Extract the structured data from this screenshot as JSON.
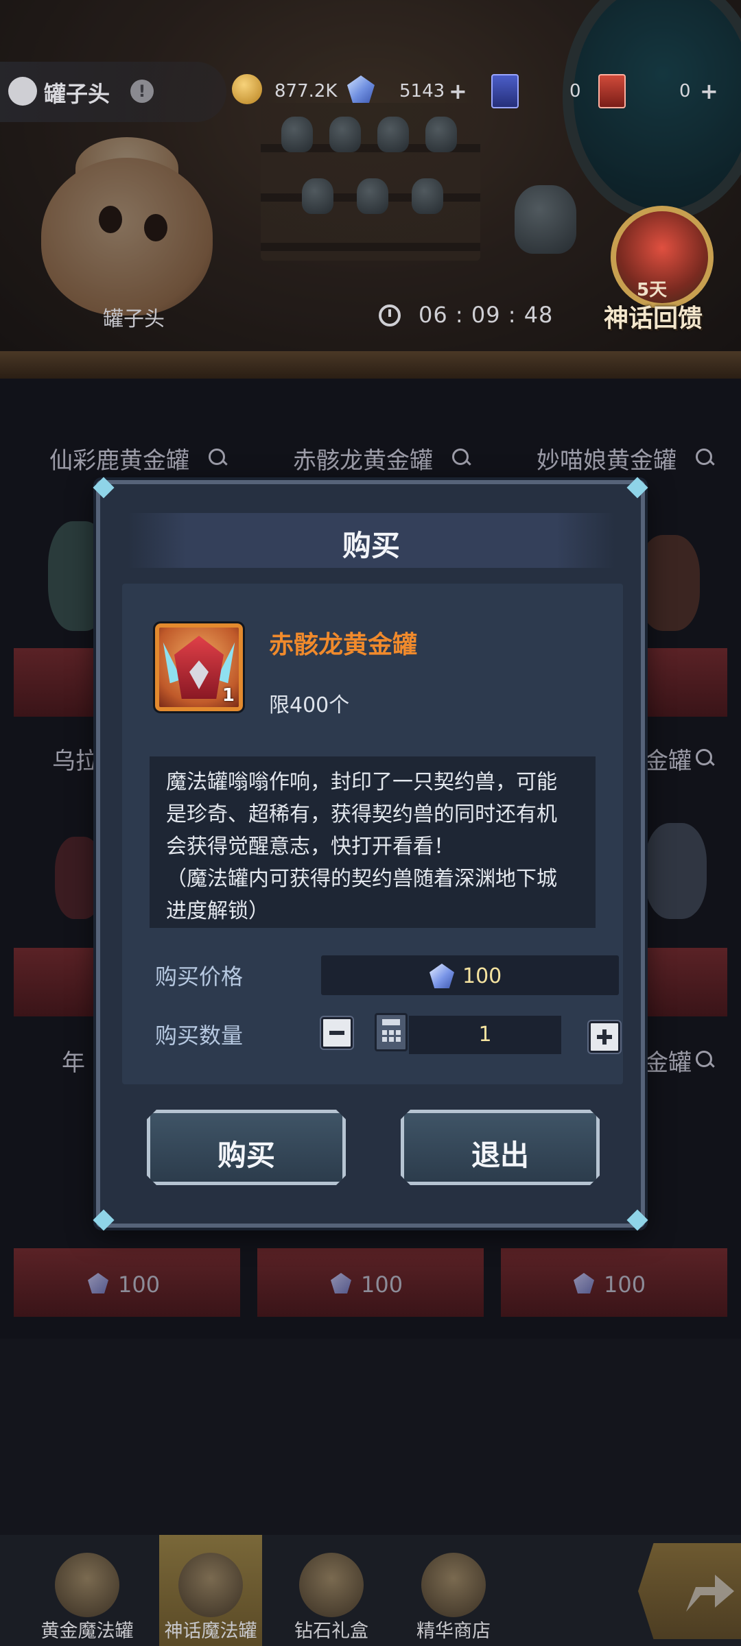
{
  "topbar": {
    "player_name": "罐子头",
    "coins": "877.2K",
    "gems": "5143",
    "blue_cards": "0",
    "red_cards": "0"
  },
  "hero": {
    "name": "罐子头",
    "timer": "06 : 09 : 48"
  },
  "event": {
    "days": "5天",
    "name": "神话回馈"
  },
  "shop": {
    "titles": [
      "仙彩鹿黄金罐",
      "赤骸龙黄金罐",
      "妙喵娘黄金罐"
    ],
    "row2_left": "乌拉",
    "row2_right": "金罐",
    "row3_left": "年",
    "row3_right": "金罐",
    "prices": [
      "100",
      "100",
      "100"
    ]
  },
  "modal": {
    "title": "购买",
    "item_name": "赤骸龙黄金罐",
    "item_count": "1",
    "limit": "限400个",
    "description_lines": [
      "魔法罐嗡嗡作响，封印了一只契约兽，可能",
      "是珍奇、超稀有，获得契约兽的同时还有机",
      "会获得觉醒意志，快打开看看！",
      "（魔法罐内可获得的契约兽随着深渊地下城",
      "进度解锁）"
    ],
    "price_label": "购买价格",
    "price_value": "100",
    "quantity_label": "购买数量",
    "quantity_value": "1",
    "buy_button": "购买",
    "exit_button": "退出"
  },
  "nav": {
    "items": [
      "黄金魔法罐",
      "神话魔法罐",
      "钻石礼盒",
      "精华商店"
    ]
  },
  "colors": {
    "item_name": "#f08a2c",
    "value_text": "#f5e3a0",
    "modal_bg": "#263041"
  }
}
